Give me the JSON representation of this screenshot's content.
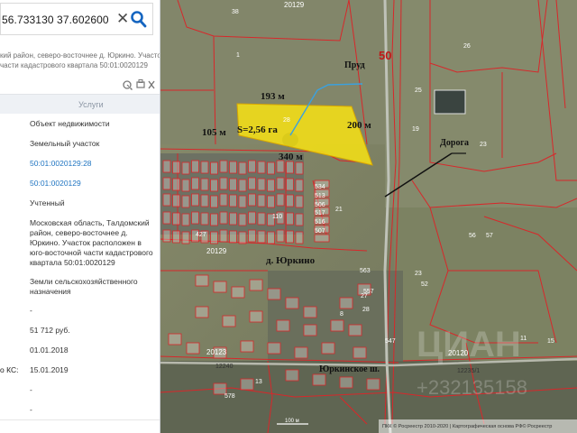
{
  "search": {
    "query": "56.733130 37.602600"
  },
  "info": {
    "description": [
      "кий район, северо-восточнее д. Юркино. Участок",
      "части кадастрового квартала 50:01:0020129"
    ],
    "header": "Услуги",
    "rows": [
      {
        "label": "",
        "value": [
          "Объект недвижимости"
        ]
      },
      {
        "label": "",
        "value": [
          "Земельный участок"
        ]
      },
      {
        "label": "",
        "value": [
          "50:01:0020129:28"
        ],
        "link": true
      },
      {
        "label": "",
        "value": [
          "50:01:0020129"
        ],
        "link": true
      },
      {
        "label": "",
        "value": [
          "Учтенный"
        ]
      },
      {
        "label": "",
        "value": [
          "Московская область, Талдомский",
          "район, северо-восточнее д.",
          "Юркино. Участок расположен в",
          "юго-восточной части кадастрового",
          "квартала 50:01:0020129"
        ]
      },
      {
        "label": "",
        "value": [
          "Земли сельскохозяйственного",
          "назначения"
        ]
      },
      {
        "label": "",
        "value": [
          "-"
        ]
      },
      {
        "label": "",
        "value": [
          "51 712 руб."
        ]
      },
      {
        "label": "",
        "value": [
          "01.01.2018"
        ]
      },
      {
        "label": "о КС:",
        "value": [
          "15.01.2019"
        ]
      },
      {
        "label": "",
        "value": [
          "-"
        ]
      },
      {
        "label": "",
        "value": [
          "-"
        ]
      }
    ]
  },
  "map": {
    "labels": {
      "area": "S=2,56 га",
      "side_top": "193 м",
      "side_left": "105 м",
      "side_right": "200 м",
      "side_bottom": "340 м",
      "pond": "Пруд",
      "road": "Дорога",
      "village": "д. Юркино",
      "street": "Юркинское ш.",
      "road_num": "50",
      "quarter_top": "20129",
      "quarter_mid": "20129",
      "quarter_bottom": "20123",
      "quarter_right": "20120",
      "hw_left": "12240",
      "hw_right": "12235/1",
      "scale": "100 м",
      "attribution": "ПКК © Росреестр 2010-2020 | Картографическая основа РФ© Росреестр",
      "watermark": "ЦИАН",
      "watermark_id": "+232135158"
    },
    "parcels": [
      "38",
      "1",
      "26",
      "25",
      "19",
      "28",
      "56",
      "23",
      "57",
      "21",
      "23",
      "110",
      "427",
      "534",
      "513",
      "506",
      "517",
      "516",
      "507",
      "563",
      "557",
      "52",
      "27",
      "28",
      "8",
      "11",
      "15",
      "547",
      "578",
      "13"
    ]
  }
}
